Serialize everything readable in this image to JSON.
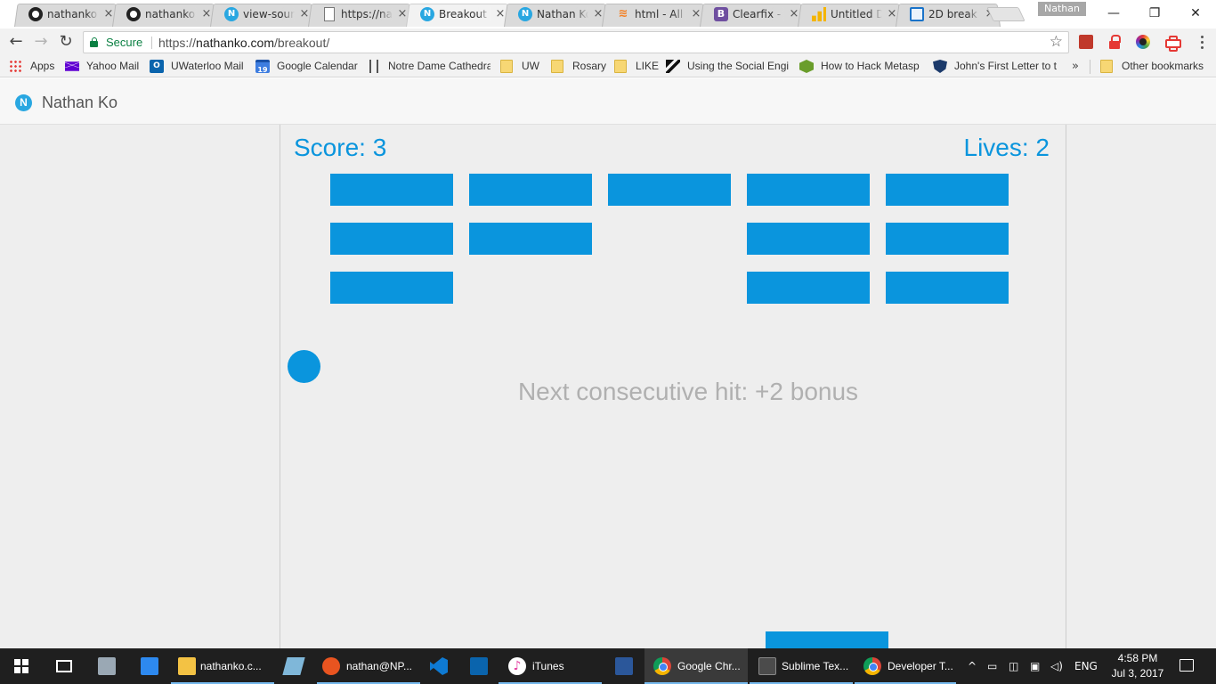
{
  "browser": {
    "tabs": [
      {
        "title": "nathanko",
        "icon": "github-icon"
      },
      {
        "title": "nathanko",
        "icon": "github-icon"
      },
      {
        "title": "view-source",
        "icon": "n-logo-icon"
      },
      {
        "title": "https://na",
        "icon": "document-icon"
      },
      {
        "title": "Breakout",
        "icon": "n-logo-icon",
        "active": true
      },
      {
        "title": "Nathan Ko",
        "icon": "n-logo-icon"
      },
      {
        "title": "html - All",
        "icon": "stackoverflow-icon"
      },
      {
        "title": "Clearfix -",
        "icon": "bootstrap-icon"
      },
      {
        "title": "Untitled D",
        "icon": "analytics-icon"
      },
      {
        "title": "2D break",
        "icon": "game-icon"
      }
    ],
    "tab_close_glyph": "×",
    "profile_name": "Nathan",
    "window": {
      "minimize": "—",
      "maximize": "❐",
      "close": "✕"
    },
    "toolbar": {
      "back": "←",
      "forward": "→",
      "reload": "↻",
      "secure_label": "Secure",
      "url_scheme": "https://",
      "url_host": "nathanko.com",
      "url_path": "/breakout/",
      "star": "☆"
    },
    "bookmarks": [
      {
        "label": "Apps",
        "icon": "apps-grid-icon"
      },
      {
        "label": "Yahoo Mail",
        "icon": "yahoo-mail-icon"
      },
      {
        "label": "UWaterloo Mail",
        "icon": "outlook-icon"
      },
      {
        "label": "Google Calendar",
        "icon": "calendar-icon"
      },
      {
        "label": "Notre Dame Cathedra",
        "icon": "cathedral-icon"
      },
      {
        "label": "UW",
        "icon": "folder-icon"
      },
      {
        "label": "Rosary",
        "icon": "folder-icon"
      },
      {
        "label": "LIKE",
        "icon": "folder-icon"
      },
      {
        "label": "Using the Social Engi",
        "icon": "social-engineering-icon"
      },
      {
        "label": "How to Hack Metasp",
        "icon": "metasploit-icon"
      },
      {
        "label": "John's First Letter to t",
        "icon": "shield-icon"
      }
    ],
    "bookmarks_more": "»",
    "other_bookmarks": "Other bookmarks",
    "outlook_glyph": "O",
    "calendar_day": "19"
  },
  "site": {
    "logo_letter": "N",
    "name": "Nathan Ko"
  },
  "game": {
    "score_label": "Score: 3",
    "lives_label": "Lives: 2",
    "bonus_message": "Next consecutive hit: +2 bonus",
    "brick_color": "#0a95dd",
    "bricks_grid": [
      [
        true,
        true,
        true,
        true,
        true
      ],
      [
        true,
        true,
        false,
        true,
        true
      ],
      [
        true,
        false,
        false,
        true,
        true
      ]
    ]
  },
  "taskbar": {
    "items": [
      {
        "label": "nathanko.c...",
        "icon": "file-explorer-icon"
      },
      {
        "label": "nathan@NP...",
        "icon": "ubuntu-icon"
      },
      {
        "label": "iTunes",
        "icon": "itunes-icon"
      },
      {
        "label": "Google Chr...",
        "icon": "chrome-icon"
      },
      {
        "label": "Sublime Tex...",
        "icon": "sublime-text-icon"
      },
      {
        "label": "Developer T...",
        "icon": "chrome-icon"
      }
    ],
    "tray_up": "^",
    "language": "ENG",
    "time": "4:58 PM",
    "date": "Jul 3, 2017"
  }
}
